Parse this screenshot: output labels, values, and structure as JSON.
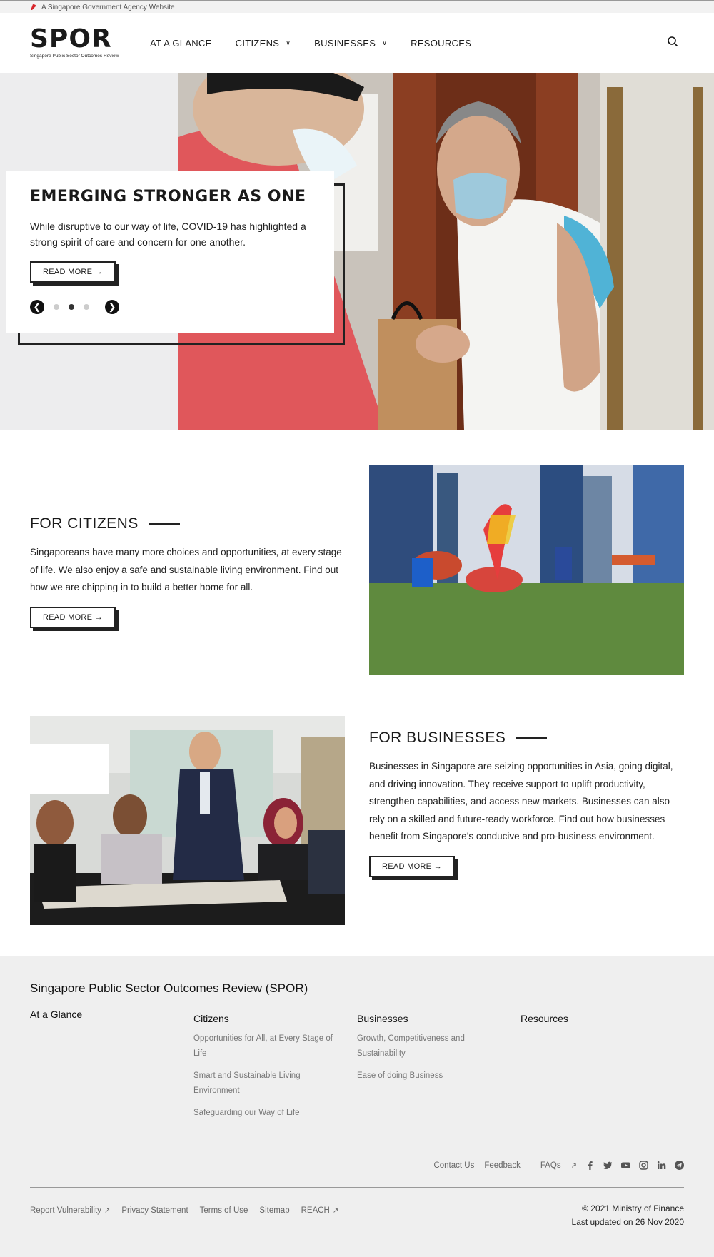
{
  "masthead": {
    "text": "A Singapore Government Agency Website"
  },
  "header": {
    "logo": "SPOR",
    "logo_sub": "Singapore Public Sector Outcomes Review",
    "nav": [
      {
        "label": "AT A GLANCE",
        "has_dropdown": false
      },
      {
        "label": "CITIZENS",
        "has_dropdown": true
      },
      {
        "label": "BUSINESSES",
        "has_dropdown": true
      },
      {
        "label": "RESOURCES",
        "has_dropdown": false
      }
    ]
  },
  "hero": {
    "title": "EMERGING STRONGER AS ONE",
    "description": "While disruptive to our way of life, COVID-19 has highlighted a strong spirit of care and concern for one another.",
    "button": "READ MORE",
    "slides": 3,
    "active_slide": 2
  },
  "citizens": {
    "title": "FOR CITIZENS",
    "description": "Singaporeans have many more choices and opportunities, at every stage of life. We also enjoy a safe and sustainable living environment. Find out how we are chipping in to build a better home for all.",
    "button": "READ MORE"
  },
  "businesses": {
    "title": "FOR BUSINESSES",
    "description": "Businesses in Singapore are seizing opportunities in Asia, going digital, and driving innovation. They receive support to uplift productivity, strengthen capabilities, and access new markets. Businesses can also rely on a skilled and future-ready workforce. Find out how businesses benefit from Singapore’s conducive and pro-business environment.",
    "button": "READ MORE"
  },
  "footer": {
    "title": "Singapore Public Sector Outcomes Review (SPOR)",
    "columns": [
      {
        "head": "At a Glance",
        "links": []
      },
      {
        "head": "Citizens",
        "links": [
          "Opportunities for All, at Every Stage of Life",
          "Smart and Sustainable Living Environment",
          "Safeguarding our Way of Life"
        ]
      },
      {
        "head": "Businesses",
        "links": [
          "Growth, Competitiveness and Sustainability",
          "Ease of doing Business"
        ]
      },
      {
        "head": "Resources",
        "links": []
      }
    ],
    "right_links": {
      "contact": "Contact Us",
      "feedback": "Feedback",
      "faqs": "FAQs"
    },
    "social_icons": [
      "facebook-icon",
      "twitter-icon",
      "youtube-icon",
      "instagram-icon",
      "linkedin-icon",
      "telegram-icon"
    ],
    "bottom_links": {
      "vulnerability": "Report Vulnerability",
      "privacy": "Privacy Statement",
      "terms": "Terms of Use",
      "sitemap": "Sitemap",
      "reach": "REACH"
    },
    "copyright": "© 2021 Ministry of Finance",
    "updated": "Last updated on 26 Nov 2020"
  },
  "colors": {
    "accent_dark": "#222222",
    "footer_bg": "#efefef",
    "hero_bg": "#ededee"
  }
}
